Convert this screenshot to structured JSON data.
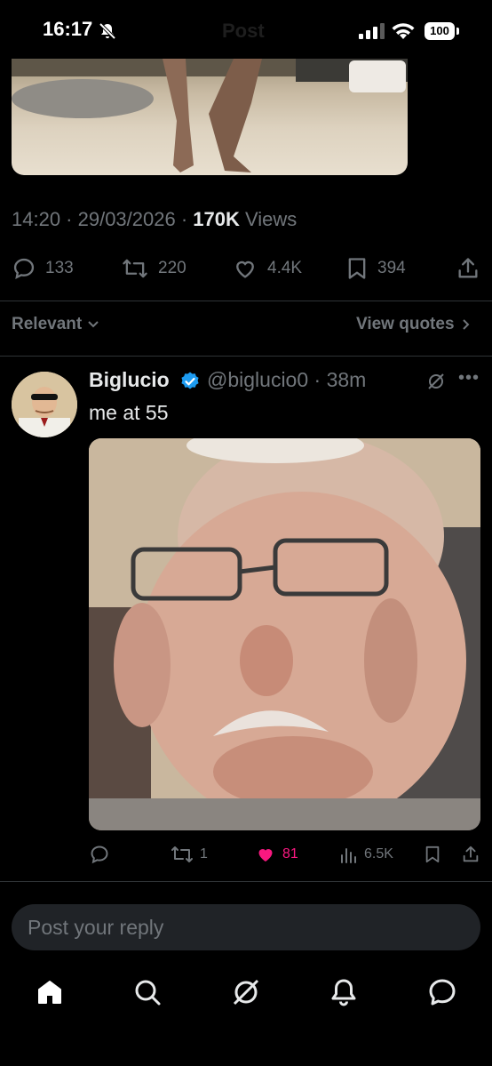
{
  "status_bar": {
    "time": "16:17",
    "battery": "100",
    "ghost_title": "Post"
  },
  "post": {
    "timestamp": "14:20 · 29/03/2026 · ",
    "views_count": "170K",
    "views_label": " Views",
    "actions": {
      "replies": "133",
      "reposts": "220",
      "likes": "4.4K",
      "bookmarks": "394"
    }
  },
  "filter": {
    "sort_label": "Relevant",
    "view_quotes_label": "View quotes"
  },
  "reply": {
    "name": "Biglucio",
    "handle_time": "@biglucio0 · 38m",
    "text": "me at 55",
    "actions": {
      "reposts": "1",
      "likes": "81",
      "views": "6.5K"
    }
  },
  "composer": {
    "placeholder": "Post your reply"
  },
  "tabs": [
    "home-icon",
    "search-icon",
    "grok-icon",
    "notifications-icon",
    "messages-icon"
  ],
  "colors": {
    "background": "#000000",
    "text": "#e7e9ea",
    "secondary": "#71767b",
    "like": "#f91880",
    "verified": "#1d9bf0"
  }
}
